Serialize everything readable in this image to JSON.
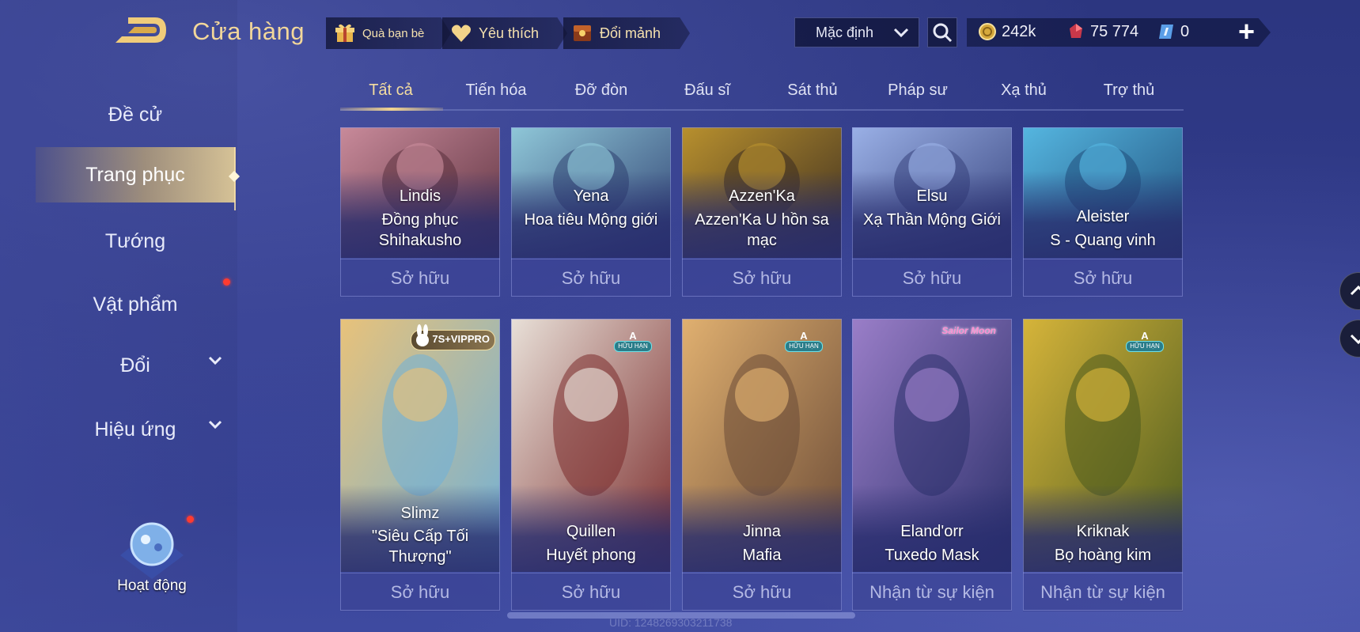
{
  "header": {
    "title": "Cửa hàng",
    "buttons": [
      {
        "label": "Quà bạn bè",
        "icon": "gift-icon"
      },
      {
        "label": "Yêu thích",
        "icon": "heart-icon"
      },
      {
        "label": "Đổi mảnh",
        "icon": "fragment-chest-icon"
      }
    ],
    "sort": {
      "value": "Mặc định"
    },
    "currencies": [
      {
        "value": "242k",
        "icon": "gold-coin-icon"
      },
      {
        "value": "75 774",
        "icon": "red-gem-icon"
      },
      {
        "value": "0",
        "icon": "voucher-icon"
      }
    ]
  },
  "sidebar": {
    "items": [
      {
        "label": "Đề cử"
      },
      {
        "label": "Trang phục",
        "active": true
      },
      {
        "label": "Tướng"
      },
      {
        "label": "Vật phẩm",
        "notification": true
      },
      {
        "label": "Đổi",
        "expandable": true
      },
      {
        "label": "Hiệu ứng",
        "expandable": true
      }
    ],
    "activity": {
      "label": "Hoạt động",
      "notification": true
    }
  },
  "tabs": [
    "Tất cả",
    "Tiến hóa",
    "Đỡ đòn",
    "Đấu sĩ",
    "Sát thủ",
    "Pháp sư",
    "Xạ thủ",
    "Trợ thủ"
  ],
  "active_tab": "Tất cả",
  "cards_row1": [
    {
      "hero": "Lindis",
      "skin": "Đồng phục Shihakusho",
      "status": "Sở hữu",
      "colors": [
        "#5a2f3d",
        "#c88a9a"
      ]
    },
    {
      "hero": "Yena",
      "skin": "Hoa tiêu Mộng giới",
      "status": "Sở hữu",
      "colors": [
        "#2e3f70",
        "#8fc7d8"
      ]
    },
    {
      "hero": "Azzen'Ka",
      "skin": "Azzen'Ka U hồn sa mạc",
      "status": "Sở hữu",
      "colors": [
        "#3a2c20",
        "#b8902e"
      ]
    },
    {
      "hero": "Elsu",
      "skin": "Xạ Thần Mộng Giới",
      "status": "Sở hữu",
      "colors": [
        "#34407a",
        "#9ab0e6"
      ]
    },
    {
      "hero": "Aleister",
      "skin": "S - Quang vinh",
      "status": "Sở hữu",
      "colors": [
        "#1f4d7a",
        "#55b6e0"
      ]
    }
  ],
  "cards_row2": [
    {
      "hero": "Slimz",
      "skin": "\"Siêu Cấp Tối Thượng\"",
      "status": "Sở hữu",
      "badge": "7S+VIPPRO",
      "colors": [
        "#6fb0d8",
        "#e8c27a"
      ]
    },
    {
      "hero": "Quillen",
      "skin": "Huyết phong",
      "status": "Sở hữu",
      "badge_a": {
        "letter": "A",
        "text": "HỮU HẠN"
      },
      "colors": [
        "#7a2a2a",
        "#e8e0d8"
      ]
    },
    {
      "hero": "Jinna",
      "skin": "Mafia",
      "status": "Sở hữu",
      "badge_a": {
        "letter": "A",
        "text": "HỮU HẠN"
      },
      "colors": [
        "#6a4a36",
        "#e0b070"
      ]
    },
    {
      "hero": "Eland'orr",
      "skin": "Tuxedo Mask",
      "status": "Nhận từ sự kiện",
      "badge_logo": "Sailor Moon",
      "colors": [
        "#2a2f6a",
        "#9a7ec8"
      ]
    },
    {
      "hero": "Kriknak",
      "skin": "Bọ hoàng kim",
      "status": "Nhận từ sự kiện",
      "badge_a": {
        "letter": "A",
        "text": "HỮU HẠN"
      },
      "colors": [
        "#4a5a1e",
        "#d6b43a"
      ]
    }
  ],
  "footer": {
    "uid": "UID: 1248269303211738"
  },
  "accent": {
    "gold": "#f2d79a",
    "tab_active": "#f4dda0",
    "status_text": "#b4b9e4"
  }
}
